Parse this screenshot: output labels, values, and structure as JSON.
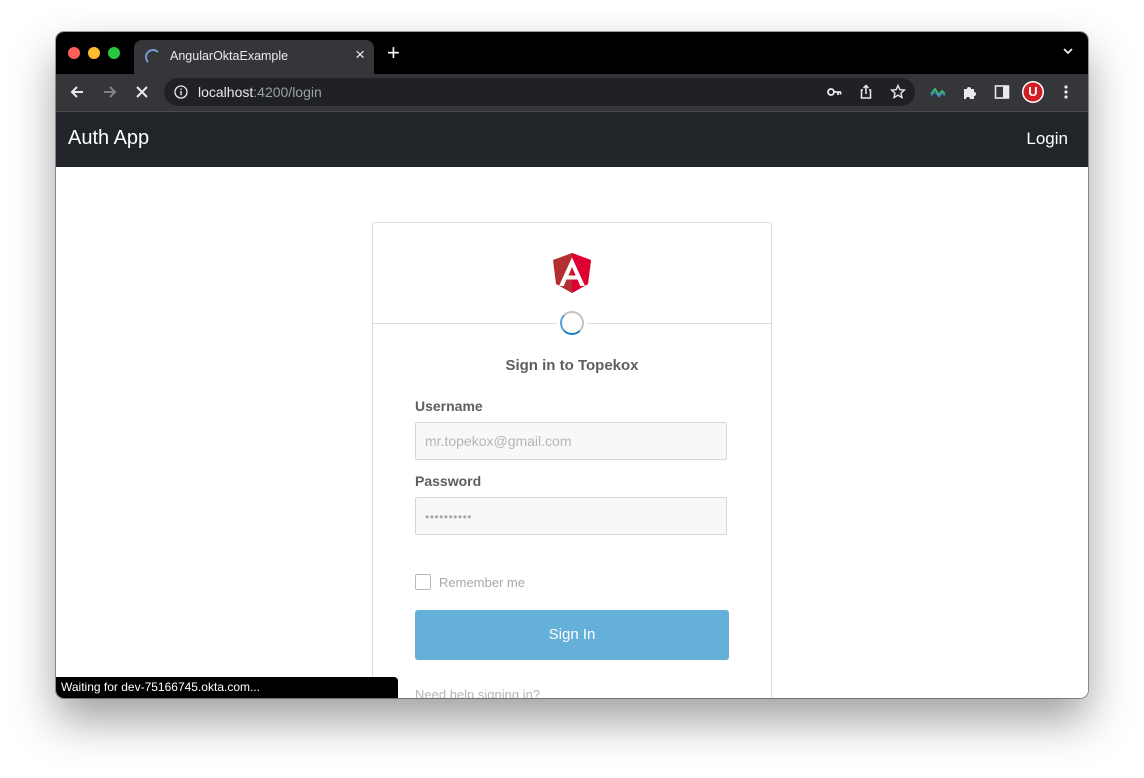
{
  "browser": {
    "tab": {
      "title": "AngularOktaExample"
    },
    "new_tab_label": "+",
    "tab_close_glyph": "×",
    "url": {
      "host": "localhost",
      "path": ":4200/login"
    },
    "icons": {
      "back": "arrow-left-icon",
      "forward": "arrow-right-icon",
      "stop": "close-icon",
      "info": "info-icon",
      "key": "key-icon",
      "share": "share-icon",
      "bookmark": "star-icon",
      "extension_wave": "wave-icon",
      "extensions": "puzzle-icon",
      "side_panel": "side-panel-icon",
      "menu": "kebab-menu-icon",
      "tab_search": "chevron-down-icon"
    },
    "profile_initial": "U"
  },
  "navbar": {
    "brand": "Auth App",
    "login_link": "Login",
    "background": "#212529"
  },
  "signin_widget": {
    "title": "Sign in to Topekox",
    "logo": "angular-logo",
    "username": {
      "label": "Username",
      "placeholder": "mr.topekox@gmail.com"
    },
    "password": {
      "label": "Password",
      "masked_value": "••••••••••"
    },
    "remember_me": "Remember me",
    "submit_label": "Sign In",
    "help_link": "Need help signing in?",
    "button_color": "#65b0d8"
  },
  "status_bar": {
    "text": "Waiting for dev-75166745.okta.com..."
  }
}
